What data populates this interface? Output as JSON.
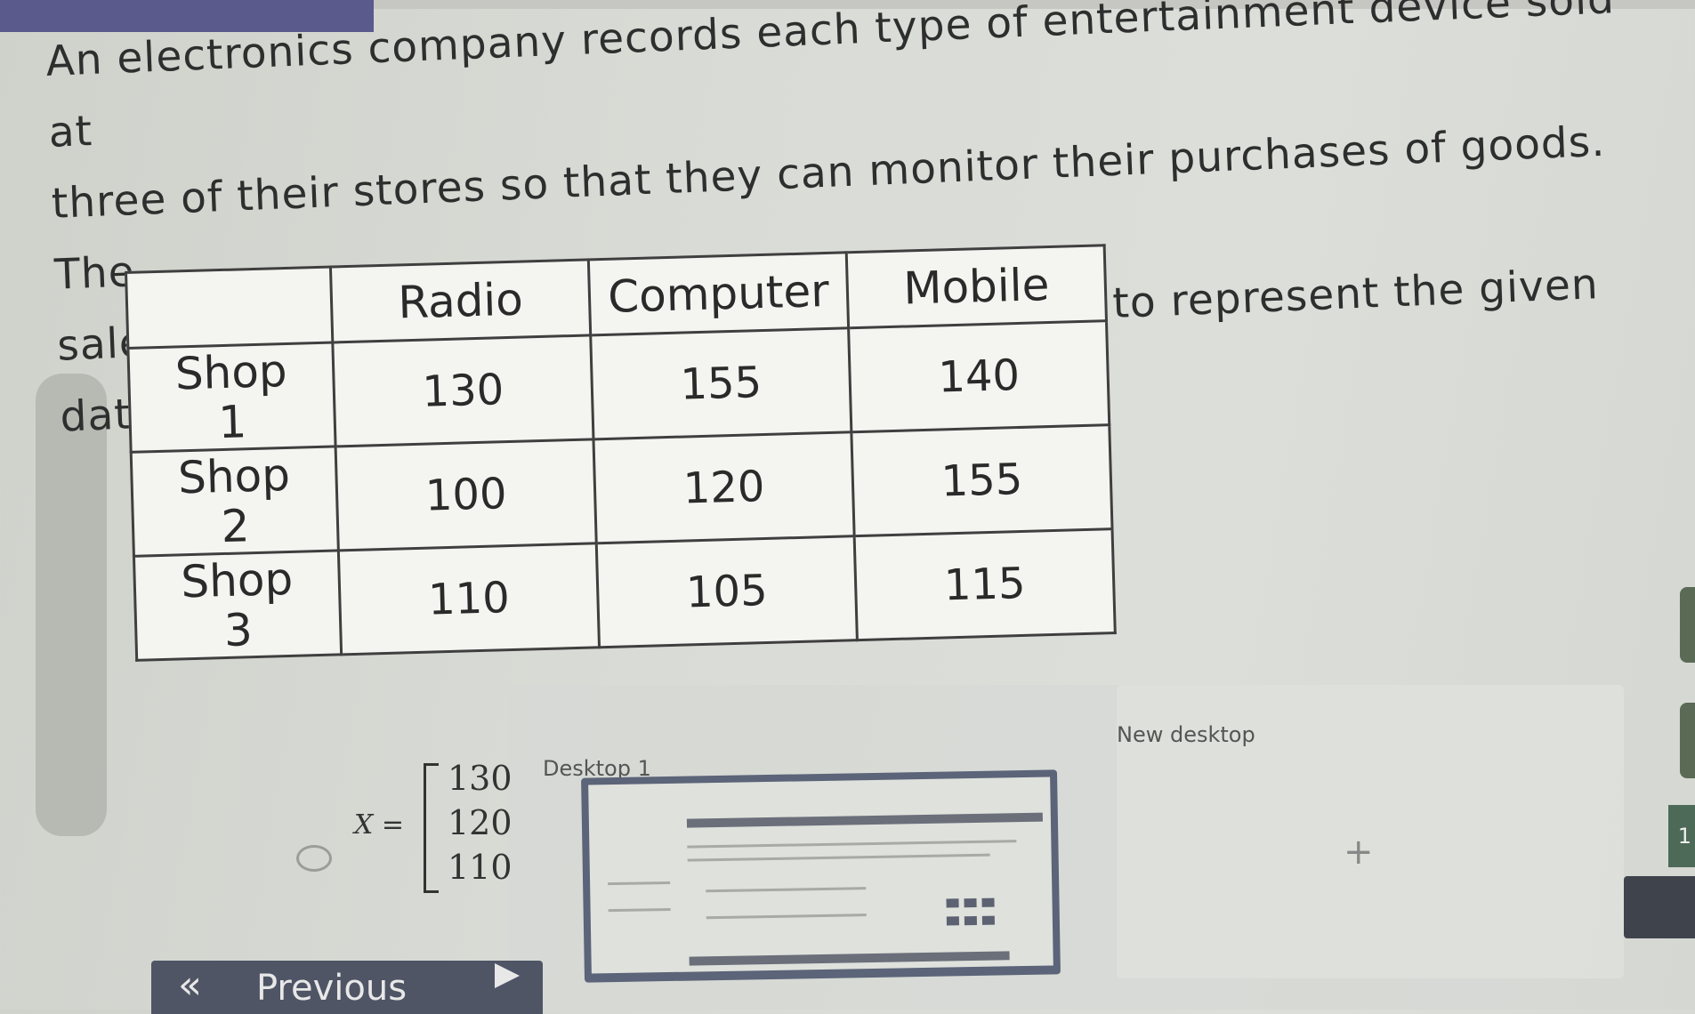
{
  "question": {
    "line1": "An electronics company records each type of entertainment device sold at",
    "line2": "three of their stores so that they can monitor their purchases of goods. The",
    "line3": "sales in a month are shown below. Use a matrix to represent the given data."
  },
  "table": {
    "headers": [
      "",
      "Radio",
      "Computer",
      "Mobile"
    ],
    "rows": [
      {
        "label_top": "Shop",
        "label_bottom": "1",
        "values": [
          "130",
          "155",
          "140"
        ]
      },
      {
        "label_top": "Shop",
        "label_bottom": "2",
        "values": [
          "100",
          "120",
          "155"
        ]
      },
      {
        "label_top": "Shop",
        "label_bottom": "3",
        "values": [
          "110",
          "105",
          "115"
        ]
      }
    ]
  },
  "answer_option": {
    "lhs": "X =",
    "values": [
      "130",
      "120",
      "110"
    ]
  },
  "desktop_switcher": {
    "desktop1_label": "Desktop 1",
    "new_desktop_label": "New desktop",
    "add_symbol": "+"
  },
  "navigation": {
    "previous_icon": "double-chevron-left-icon",
    "previous_label": "Previous",
    "next_icon": "play-icon"
  },
  "edge": {
    "badge_text": "1"
  }
}
